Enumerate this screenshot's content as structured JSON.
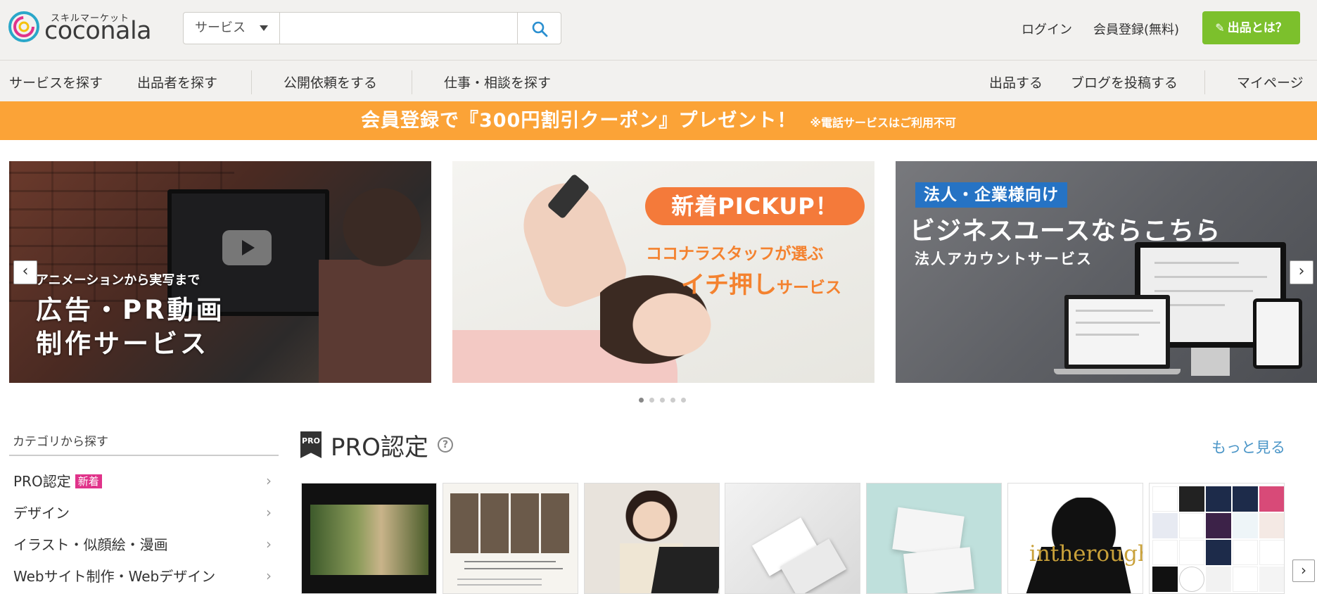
{
  "header": {
    "logo_sub": "スキルマーケット",
    "logo_text": "coconala",
    "search": {
      "category": "サービス",
      "placeholder": ""
    },
    "links": [
      "ログイン",
      "会員登録(無料)"
    ],
    "sell_button": "出品とは？"
  },
  "nav": {
    "left": [
      "サービスを探す",
      "出品者を探す",
      "公開依頼をする",
      "仕事・相談を探す"
    ],
    "right": [
      "出品する",
      "ブログを投稿する",
      "マイページ"
    ]
  },
  "promo": {
    "main": "会員登録で『300円割引クーポン』プレゼント！",
    "note": "※電話サービスはご利用不可"
  },
  "carousel": {
    "slides": [
      {
        "small": "アニメーションから実写まで",
        "line1": "広告・PR動画",
        "line2": "制作サービス"
      },
      {
        "pill": "新着PICKUP！",
        "line1": "ココナラスタッフが選ぶ",
        "line2_big": "イチ押し",
        "line2_small": "サービス"
      },
      {
        "tag": "法人・企業様向け",
        "big": "ビジネスユースならこちら",
        "sub": "法人アカウントサービス"
      }
    ],
    "prev_label": "‹",
    "next_label": "›",
    "dots": 5,
    "active_dot": 0
  },
  "sidebar": {
    "title": "カテゴリから探す",
    "items": [
      {
        "label": "PRO認定",
        "badge": "新着"
      },
      {
        "label": "デザイン"
      },
      {
        "label": "イラスト・似顔絵・漫画"
      },
      {
        "label": "Webサイト制作・Webデザイン"
      }
    ]
  },
  "pro_section": {
    "icon_label": "PRO",
    "title": "PRO認定",
    "help": "?",
    "more": "もっと見る",
    "thumb6_text": "intherough",
    "next_label": "›"
  },
  "colors": {
    "accent_green": "#7cc02c",
    "promo_orange": "#fba337",
    "link_blue": "#4a95c7",
    "badge_pink": "#e0338a"
  }
}
